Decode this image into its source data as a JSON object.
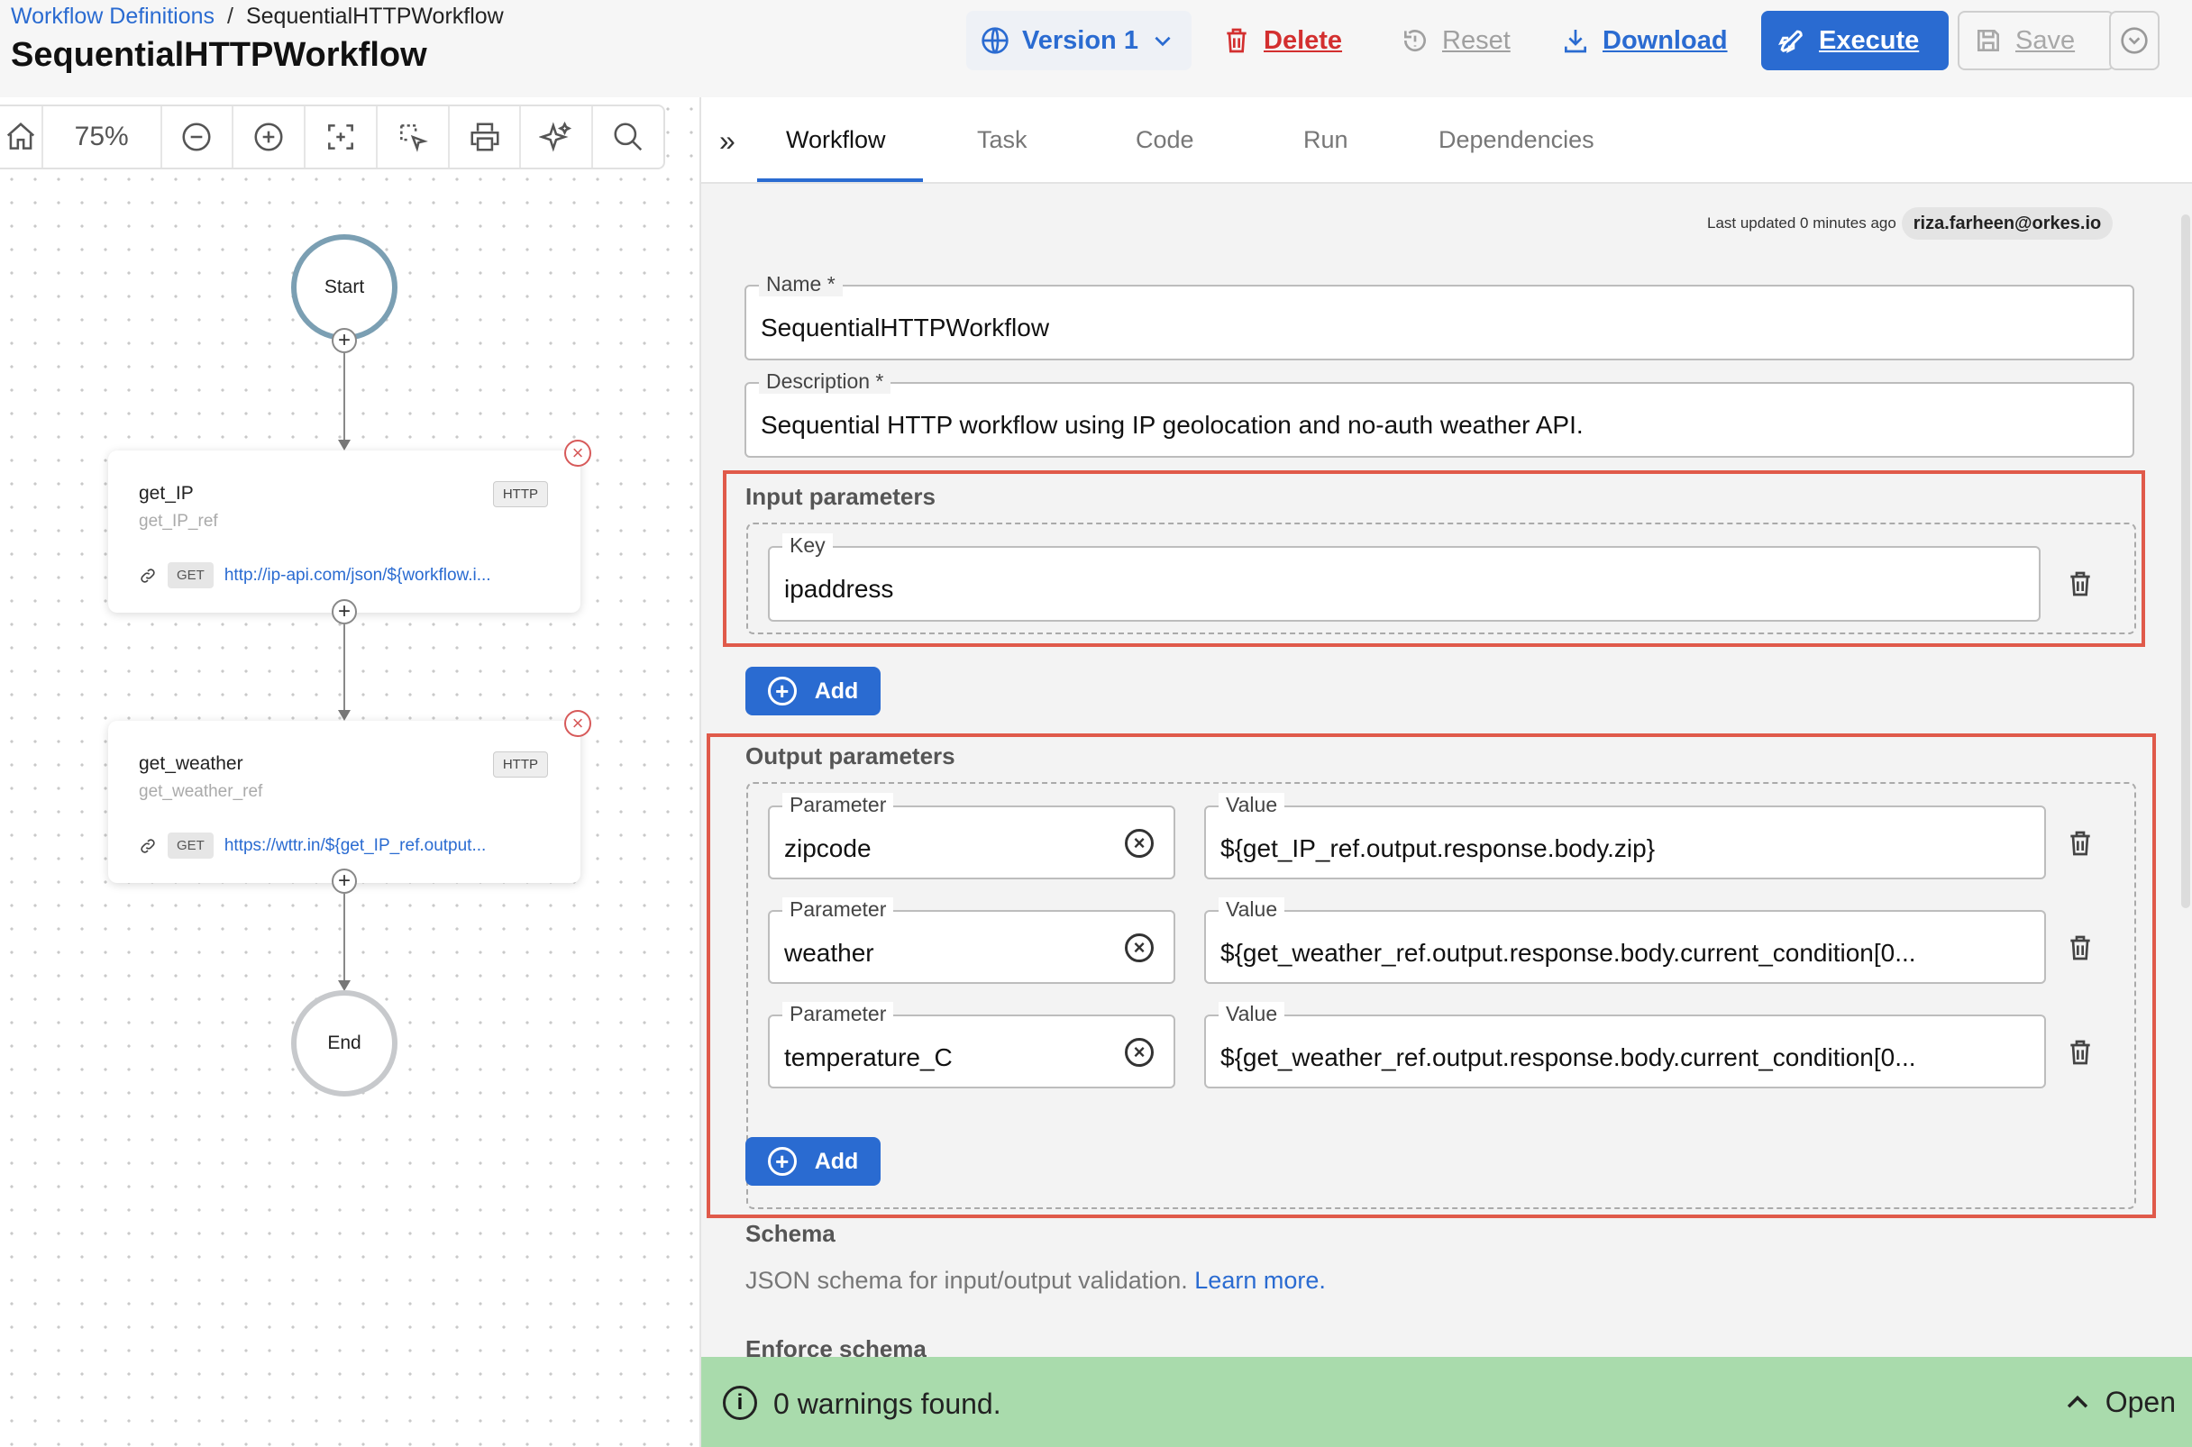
{
  "breadcrumb": {
    "parent": "Workflow Definitions",
    "separator": "/",
    "current": "SequentialHTTPWorkflow"
  },
  "page_title": "SequentialHTTPWorkflow",
  "header_actions": {
    "version": "Version 1",
    "delete": "Delete",
    "reset": "Reset",
    "download": "Download",
    "execute": "Execute",
    "save": "Save"
  },
  "toolbar": {
    "zoom": "75%"
  },
  "diagram": {
    "start": "Start",
    "end": "End",
    "tasks": [
      {
        "name": "get_IP",
        "ref": "get_IP_ref",
        "type": "HTTP",
        "method": "GET",
        "url": "http://ip-api.com/json/${workflow.i..."
      },
      {
        "name": "get_weather",
        "ref": "get_weather_ref",
        "type": "HTTP",
        "method": "GET",
        "url": "https://wttr.in/${get_IP_ref.output..."
      }
    ]
  },
  "tabs": [
    "Workflow",
    "Task",
    "Code",
    "Run",
    "Dependencies"
  ],
  "active_tab": "Workflow",
  "meta": {
    "last_updated": "Last updated 0 minutes ago",
    "user": "riza.farheen@orkes.io"
  },
  "form": {
    "name_label": "Name *",
    "name_value": "SequentialHTTPWorkflow",
    "description_label": "Description *",
    "description_value": "Sequential HTTP workflow using IP geolocation and no-auth weather API.",
    "input_section": "Input parameters",
    "input_params": [
      {
        "label": "Key",
        "value": "ipaddress"
      }
    ],
    "add_label": "Add",
    "output_section": "Output parameters",
    "param_label": "Parameter",
    "value_label": "Value",
    "output_params": [
      {
        "param": "zipcode",
        "value": "${get_IP_ref.output.response.body.zip}"
      },
      {
        "param": "weather",
        "value": "${get_weather_ref.output.response.body.current_condition[0..."
      },
      {
        "param": "temperature_C",
        "value": "${get_weather_ref.output.response.body.current_condition[0..."
      }
    ],
    "schema_title": "Schema",
    "schema_desc": "JSON schema for input/output validation.",
    "learn_more": "Learn more.",
    "enforce_schema": "Enforce schema"
  },
  "warnings": {
    "message": "0 warnings found.",
    "open": "Open"
  },
  "colors": {
    "accent": "#2a6bd1",
    "danger": "#d32f2f",
    "highlight_box": "#e05a4a",
    "warning_bar": "#a9dbac"
  }
}
